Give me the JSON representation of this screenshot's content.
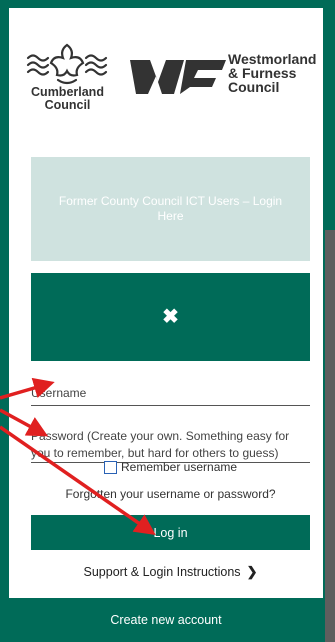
{
  "branding": {
    "cumberland_line1": "Cumberland",
    "cumberland_line2": "Council",
    "westmorland_line1": "Westmorland",
    "westmorland_line2": "& Furness",
    "westmorland_line3": "Council"
  },
  "former_button_label": "Former County Council ICT Users – Login Here",
  "username": {
    "placeholder": "Username"
  },
  "password": {
    "placeholder": "Password (Create your own. Something easy for you to remember, but hard for others to guess)"
  },
  "remember_label": "Remember username",
  "forgot_link": "Forgotten your username or password?",
  "login_button": "Log in",
  "support_link": "Support & Login Instructions",
  "create_account": "Create new account",
  "colors": {
    "brand": "#006b58",
    "light_button": "#cfe2df",
    "annotation_arrow": "#e02020"
  },
  "icons": {
    "close": "close-icon",
    "chevron": "chevron-right-icon",
    "checkbox": "checkbox-icon"
  }
}
